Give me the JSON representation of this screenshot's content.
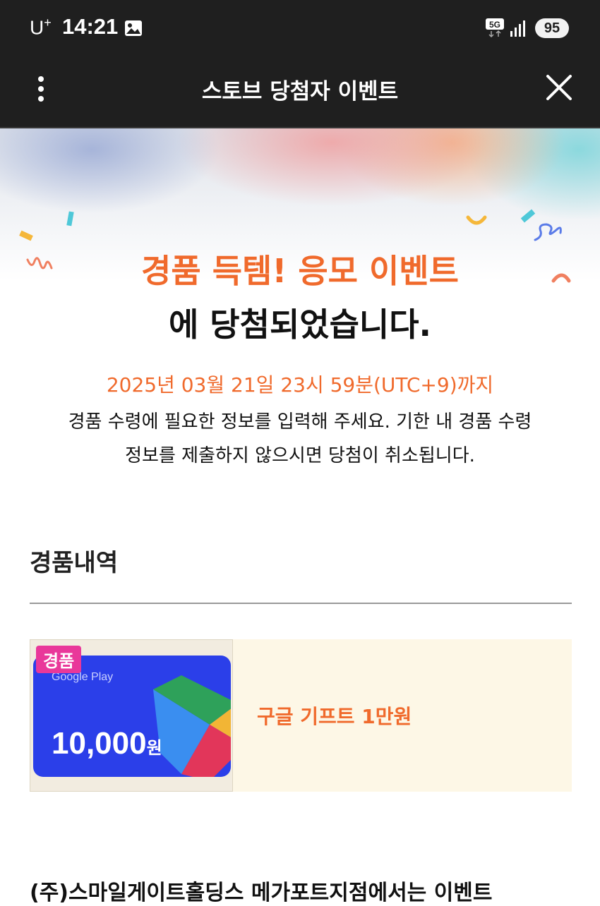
{
  "status_bar": {
    "carrier": "U",
    "carrier_sup": "+",
    "time": "14:21",
    "network": "5G",
    "battery": "95"
  },
  "app_bar": {
    "title": "스토브 당첨자 이벤트",
    "more_icon": "more-vertical-icon",
    "close_icon": "close-icon"
  },
  "hero": {
    "headline_orange": "경품 득템! 응모 이벤트",
    "headline_black": "에 당첨되었습니다.",
    "deadline": "2025년 03월 21일 23시 59분(UTC+9)까지",
    "notice_line1": "경품 수령에 필요한 정보를 입력해 주세요. 기한 내 경품 수령",
    "notice_line2": "정보를 제출하지 않으시면 당첨이 취소됩니다."
  },
  "prizes": {
    "section_title": "경품내역",
    "items": [
      {
        "badge": "경품",
        "card_brand": "Google Play",
        "card_amount": "10,000",
        "card_unit": "원",
        "name": "구글 기프트 1만원"
      }
    ]
  },
  "footer": {
    "partial_text": "(주)스마일게이트홀딩스 메가포트지점에서는 이벤트"
  },
  "colors": {
    "accent": "#f06a2c",
    "badge": "#e9389a",
    "bar": "#1f1f1f",
    "card_bg": "#fdf7e6",
    "gift_card": "#2b3fe9"
  }
}
